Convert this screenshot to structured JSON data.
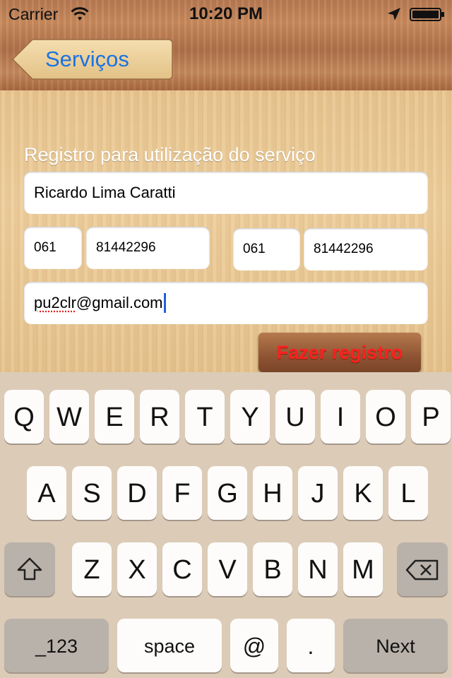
{
  "status_bar": {
    "carrier": "Carrier",
    "time": "10:20 PM"
  },
  "nav": {
    "back_label": "Serviços"
  },
  "form": {
    "title": "Registro para utilização do serviço",
    "name_value": "Ricardo Lima Caratti",
    "ddd1_value": "061",
    "phone1_value": "81442296",
    "ddd2_value": "061",
    "phone2_value": "81442296",
    "email_prefix": "pu2clr",
    "email_suffix": "@gmail.com",
    "register_label": "Fazer registro"
  },
  "keyboard": {
    "row1": [
      "Q",
      "W",
      "E",
      "R",
      "T",
      "Y",
      "U",
      "I",
      "O",
      "P"
    ],
    "row2": [
      "A",
      "S",
      "D",
      "F",
      "G",
      "H",
      "J",
      "K",
      "L"
    ],
    "row3": [
      "Z",
      "X",
      "C",
      "V",
      "B",
      "N",
      "M"
    ],
    "numbers_label": "_123",
    "space_label": "space",
    "at_label": "@",
    "dot_label": ".",
    "next_label": "Next"
  },
  "colors": {
    "accent": "#1a73e0",
    "register_text": "#ff2020",
    "cursor": "#2060e0"
  }
}
